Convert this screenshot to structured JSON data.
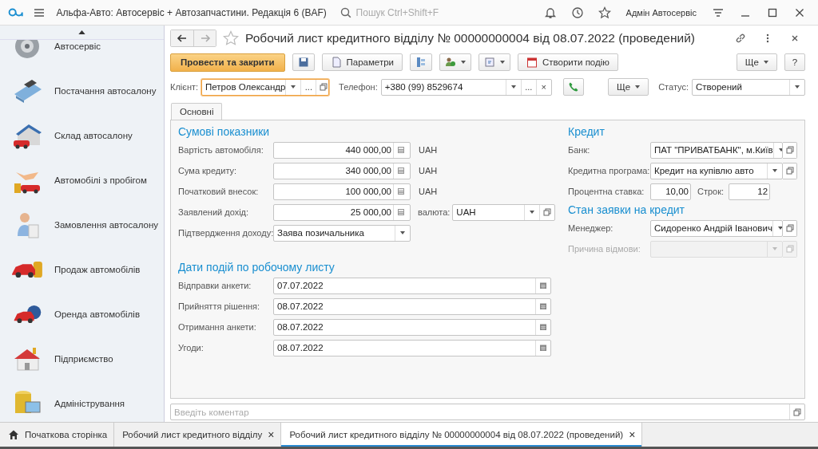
{
  "app": {
    "title": "Альфа-Авто: Автосервіс + Автозапчастини. Редакція 6  (BAF)",
    "search_placeholder": "Пошук Ctrl+Shift+F",
    "user": "Адмін Автосервіс"
  },
  "sidebar": {
    "items": [
      {
        "label": "Автосервіс"
      },
      {
        "label": "Постачання автосалону"
      },
      {
        "label": "Склад автосалону"
      },
      {
        "label": "Автомобілі з пробігом"
      },
      {
        "label": "Замовлення автосалону"
      },
      {
        "label": "Продаж автомобілів"
      },
      {
        "label": "Оренда автомобілів"
      },
      {
        "label": "Підприємство"
      },
      {
        "label": "Адміністрування"
      }
    ]
  },
  "document": {
    "title": "Робочий лист кредитного відділу № 00000000004 від 08.07.2022 (проведений)"
  },
  "toolbar": {
    "post_close": "Провести та закрити",
    "params": "Параметри",
    "create_event": "Створити подію",
    "more": "Ще",
    "help": "?"
  },
  "header_fields": {
    "client": {
      "label": "Клієнт:",
      "value": "Петров Олександр",
      "focused": true,
      "more": "..."
    },
    "phone": {
      "label": "Телефон:",
      "value": "+380 (99) 8529674",
      "focused": false,
      "more": "...",
      "clear": "×"
    },
    "more": "Ще",
    "status": {
      "label": "Статус:",
      "value": "Створений"
    }
  },
  "tabs": [
    {
      "label": "Основні",
      "selected": true
    }
  ],
  "amounts": {
    "heading": "Сумові показники",
    "fields": [
      {
        "kind": "number",
        "label": "Вартість автомобіля:",
        "value": "440 000,00",
        "suffix": "UAH"
      },
      {
        "kind": "number",
        "label": "Сума кредиту:",
        "value": "340 000,00",
        "suffix": "UAH"
      },
      {
        "kind": "number",
        "label": "Початковий внесок:",
        "value": "100 000,00",
        "suffix": "UAH"
      },
      {
        "kind": "number",
        "label": "Заявлений дохід:",
        "value": "25 000,00",
        "currency_label": "валюта:",
        "currency": "UAH"
      },
      {
        "kind": "dropdown",
        "label": "Підтвердження доходу:",
        "value": "Заява позичальника"
      }
    ]
  },
  "dates": {
    "heading": "Дати подій по робочому листу",
    "fields": [
      {
        "label": "Відправки анкети:",
        "value": "07.07.2022"
      },
      {
        "label": "Прийняття рішення:",
        "value": "08.07.2022"
      },
      {
        "label": "Отримання анкети:",
        "value": "08.07.2022"
      },
      {
        "label": "Угоди:",
        "value": "08.07.2022"
      }
    ]
  },
  "credit": {
    "heading": "Кредит",
    "fields": [
      {
        "kind": "select",
        "label": "Банк:",
        "value": "ПАТ \"ПРИВАТБАНК\", м.Київ",
        "disabled": false
      },
      {
        "kind": "select",
        "label": "Кредитна програма:",
        "value": "Кредит на купівлю авто",
        "disabled": false
      },
      {
        "kind": "pair",
        "label": "Процентна ставка:",
        "value": "10,00",
        "label2": "Строк:",
        "value2": "12",
        "disabled": false
      }
    ]
  },
  "application_state": {
    "heading": "Стан заявки на кредит",
    "fields": [
      {
        "kind": "select",
        "label": "Менеджер:",
        "value": "Сидоренко Андрій Іванович",
        "disabled": false
      },
      {
        "kind": "select",
        "label": "Причина відмови:",
        "disabled": true
      }
    ]
  },
  "comment": {
    "placeholder": "Введіть коментар"
  },
  "bottom_tabs": [
    {
      "kind": "home",
      "label": "Початкова сторінка",
      "selected": false
    },
    {
      "kind": "doc",
      "label": "Робочий лист кредитного відділу",
      "close": "×",
      "selected": false
    },
    {
      "kind": "doc",
      "label": "Робочий лист кредитного відділу № 00000000004 від 08.07.2022 (проведений)",
      "close": "×",
      "selected": true
    }
  ]
}
